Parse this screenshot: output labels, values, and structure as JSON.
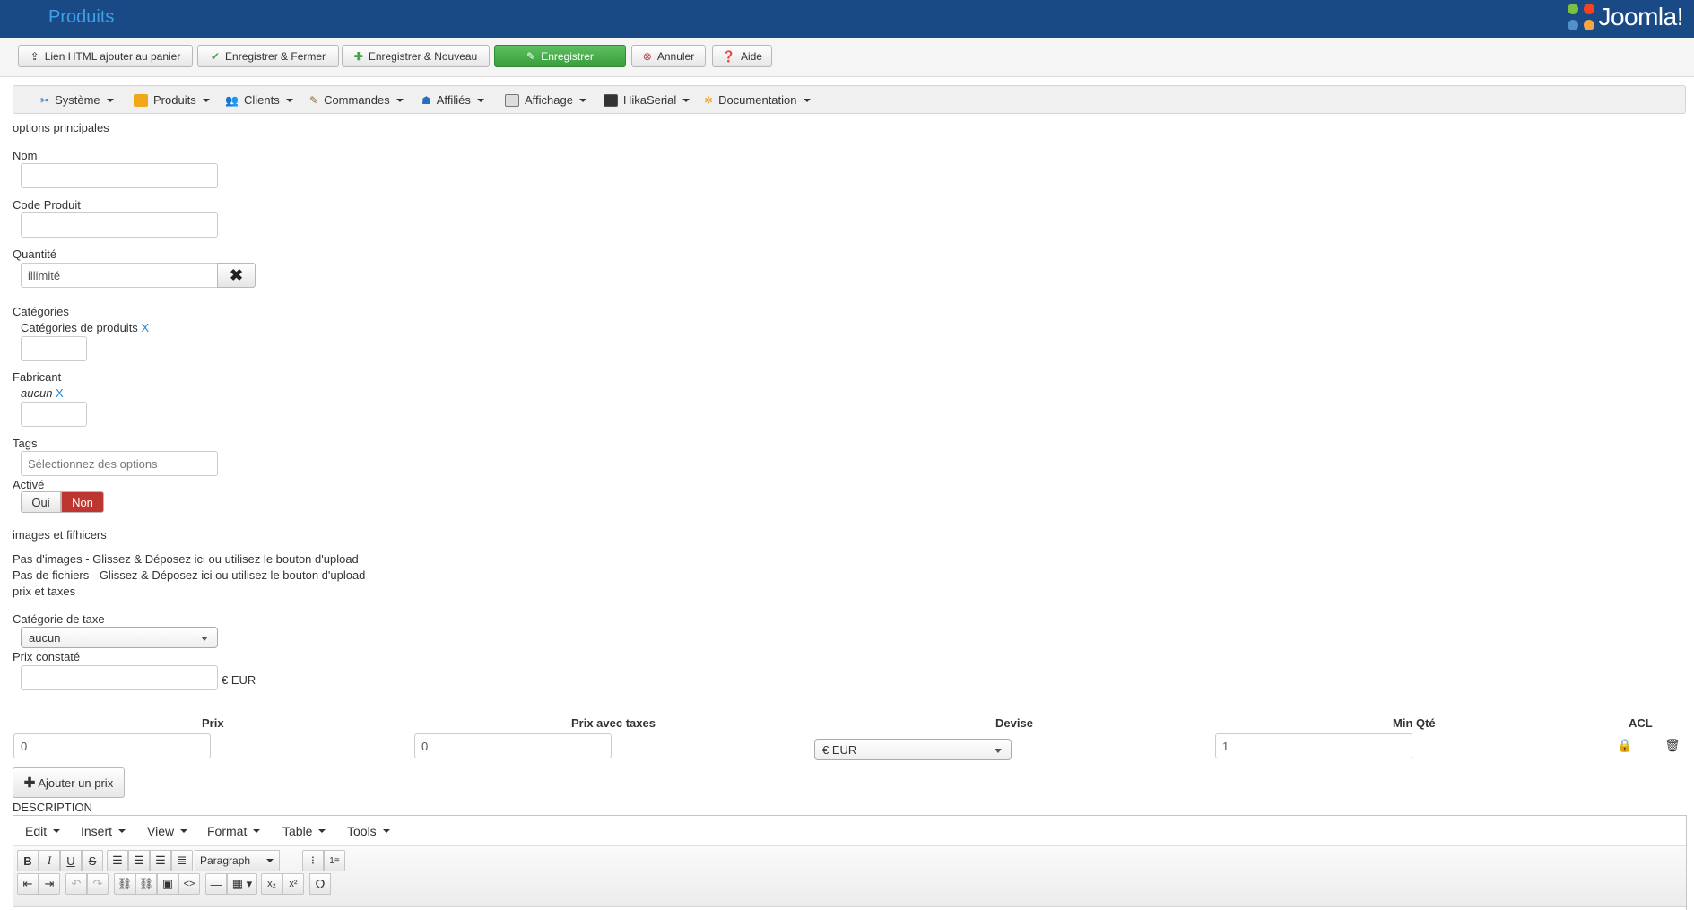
{
  "header": {
    "title": "Produits",
    "logo_text": "Joomla!"
  },
  "toolbar": {
    "buttons": [
      {
        "label": "Lien HTML ajouter au panier",
        "icon": "upload-icon"
      },
      {
        "label": "Enregistrer & Fermer",
        "icon": "check-icon"
      },
      {
        "label": "Enregistrer & Nouveau",
        "icon": "plus-icon"
      },
      {
        "label": "Enregistrer",
        "icon": "edit-icon"
      },
      {
        "label": "Annuler",
        "icon": "cancel-icon"
      },
      {
        "label": "Aide",
        "icon": "help-icon"
      }
    ]
  },
  "menu": {
    "items": [
      {
        "label": "Système",
        "icon": "tools-icon"
      },
      {
        "label": "Produits",
        "icon": "box-icon"
      },
      {
        "label": "Clients",
        "icon": "users-icon"
      },
      {
        "label": "Commandes",
        "icon": "cart-icon"
      },
      {
        "label": "Affiliés",
        "icon": "affiliate-icon"
      },
      {
        "label": "Affichage",
        "icon": "display-icon"
      },
      {
        "label": "HikaSerial",
        "icon": "serial-icon"
      },
      {
        "label": "Documentation",
        "icon": "docs-icon"
      }
    ]
  },
  "form": {
    "section_main": "options principales",
    "nom_label": "Nom",
    "nom_value": "",
    "code_label": "Code Produit",
    "code_value": "",
    "qty_label": "Quantité",
    "qty_value": "illimité",
    "categories_label": "Catégories",
    "categories_value": "Catégories de produits",
    "remove_x": "X",
    "fabricant_label": "Fabricant",
    "fabricant_value": "aucun",
    "tags_label": "Tags",
    "tags_placeholder": "Sélectionnez des options",
    "active_label": "Activé",
    "active_yes": "Oui",
    "active_no": "Non",
    "section_images": "images et fifhicers",
    "no_images": "Pas d'images - Glissez & Déposez ici ou utilisez le bouton d'upload",
    "no_files": "Pas de fichiers - Glissez & Déposez ici ou utilisez le bouton d'upload",
    "section_prices": "prix et taxes",
    "tax_label": "Catégorie de taxe",
    "tax_value": "aucun",
    "msrp_label": "Prix constaté",
    "msrp_value": "",
    "msrp_currency": "€ EUR"
  },
  "prices": {
    "headers": {
      "price": "Prix",
      "price_tax": "Prix avec taxes",
      "currency": "Devise",
      "min_qty": "Min Qté",
      "acl": "ACL"
    },
    "row": {
      "price": "0",
      "price_tax": "0",
      "currency": "€ EUR",
      "min_qty": "1"
    },
    "add_label": "Ajouter un prix"
  },
  "description": {
    "label": "DESCRIPTION",
    "menus": [
      "Edit",
      "Insert",
      "View",
      "Format",
      "Table",
      "Tools"
    ],
    "block_format": "Paragraph"
  },
  "colors": {
    "header_bg": "#1a4a85",
    "title": "#3ea0e8",
    "save_green": "#46a546",
    "toggle_red": "#bd362f",
    "link_blue": "#2384d3"
  }
}
